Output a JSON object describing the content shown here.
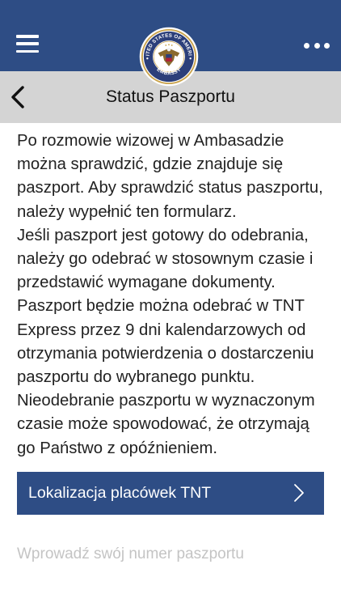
{
  "colors": {
    "primary": "#2e4d85",
    "sub_header": "#d4d4d4",
    "seal_gold": "#c9a24a"
  },
  "header": {
    "menu_icon": "hamburger-icon",
    "seal_icon": "embassy-seal-icon",
    "more_icon": "more-horizontal-icon",
    "seal_top_text": "UNITED STATES OF AMERICA",
    "seal_bottom_text": "EMBASSY"
  },
  "sub_header": {
    "back_icon": "chevron-left-icon",
    "title": "Status Paszportu"
  },
  "intro": {
    "paragraphs": [
      "Po rozmowie wizowej w Ambasadzie można sprawdzić, gdzie znajduje się paszport. Aby sprawdzić status paszportu, należy wypełnić ten formularz.",
      "Jeśli paszport jest gotowy do odebrania, należy go odebrać w stosownym czasie i przedstawić wymagane dokumenty.",
      "Paszport będzie można odebrać w TNT Express przez 9 dni kalendarzowych od otrzymania potwierdzenia o dostarczeniu paszportu do wybranego punktu.",
      "Nieodebranie paszportu w wyznaczonym czasie może spowodować, że otrzymają go Państwo z opóźnieniem."
    ]
  },
  "tnt_button": {
    "label": "Lokalizacja placówek TNT",
    "icon": "chevron-right-icon"
  },
  "passport_field": {
    "placeholder": "Wprowadź swój numer paszportu",
    "value": ""
  }
}
